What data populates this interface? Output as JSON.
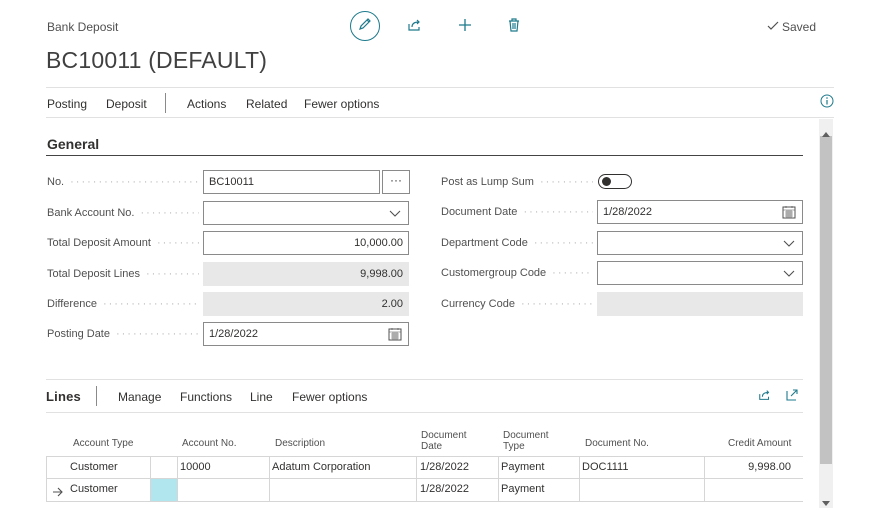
{
  "page": {
    "breadcrumb": "Bank Deposit",
    "title": "BC10011 (DEFAULT)",
    "status": "Saved"
  },
  "icons": {
    "edit": "pencil-icon",
    "share": "share-icon",
    "new": "plus-icon",
    "delete": "trash-icon",
    "saved": "checkmark-icon",
    "info": "info-icon"
  },
  "colors": {
    "accent": "#1e7a8c",
    "selected_cell": "#b2e6ee"
  },
  "menu": {
    "items": [
      "Posting",
      "Deposit",
      "Actions",
      "Related",
      "Fewer options"
    ]
  },
  "general": {
    "title": "General",
    "left": [
      {
        "label": "No.",
        "value": "BC10011",
        "kind": "text-ellipsis"
      },
      {
        "label": "Bank Account No.",
        "value": "",
        "kind": "dropdown"
      },
      {
        "label": "Total Deposit Amount",
        "value": "10,000.00",
        "kind": "number"
      },
      {
        "label": "Total Deposit Lines",
        "value": "9,998.00",
        "kind": "readonly"
      },
      {
        "label": "Difference",
        "value": "2.00",
        "kind": "readonly"
      },
      {
        "label": "Posting Date",
        "value": "1/28/2022",
        "kind": "date"
      }
    ],
    "right": [
      {
        "label": "Post as Lump Sum",
        "value": "off",
        "kind": "toggle"
      },
      {
        "label": "Document Date",
        "value": "1/28/2022",
        "kind": "date"
      },
      {
        "label": "Department Code",
        "value": "",
        "kind": "dropdown"
      },
      {
        "label": "Customergroup Code",
        "value": "",
        "kind": "dropdown"
      },
      {
        "label": "Currency Code",
        "value": "",
        "kind": "readonly"
      }
    ]
  },
  "lines": {
    "title": "Lines",
    "menu": [
      "Manage",
      "Functions",
      "Line",
      "Fewer options"
    ],
    "columns": {
      "account_type": "Account Type",
      "account_no": "Account No.",
      "description": "Description",
      "document_date_1": "Document",
      "document_date_2": "Date",
      "document_type_1": "Document",
      "document_type_2": "Type",
      "document_no": "Document No.",
      "credit_amount": "Credit Amount"
    },
    "rows": [
      {
        "account_type": "Customer",
        "account_no": "10000",
        "description": "Adatum Corporation",
        "document_date": "1/28/2022",
        "document_type": "Payment",
        "document_no": "DOC1111",
        "credit_amount": "9,998.00"
      },
      {
        "account_type": "Customer",
        "account_no": "",
        "description": "",
        "document_date": "1/28/2022",
        "document_type": "Payment",
        "document_no": "",
        "credit_amount": "",
        "current": true
      }
    ]
  }
}
